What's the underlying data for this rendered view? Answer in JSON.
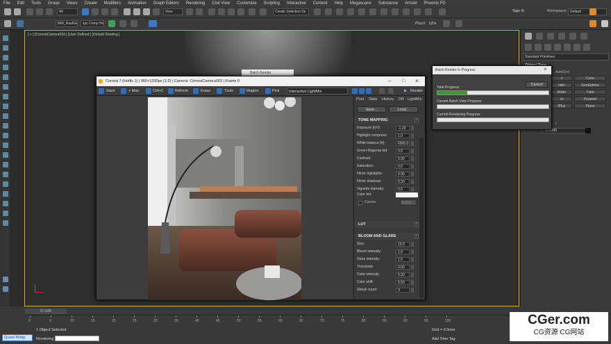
{
  "menu": [
    "File",
    "Edit",
    "Tools",
    "Group",
    "Views",
    "Create",
    "Modifiers",
    "Animation",
    "Graph Editors",
    "Rendering",
    "Civil View",
    "Customize",
    "Scripting",
    "Interactive",
    "Content",
    "Help",
    "Megascans",
    "Substance",
    "Arnold",
    "Phoenix FD"
  ],
  "account": {
    "signin": "Sign In",
    "workspaces_label": "Workspaces:",
    "workspace": "Default"
  },
  "toolbar": {
    "filter": "All",
    "view": "View",
    "selection_set": "Create Selection Se",
    "mw_label": "MW_RaafGen",
    "comp_label": "spc Comp Heli",
    "physx": "PhysX",
    "tylda": "tyDa"
  },
  "viewport": {
    "label": "[ + ] [CoronaCamera004 ] [User Defined ] [Default Shading ]"
  },
  "right_panel": {
    "section_primitives": "Standard Primitives",
    "object_type": "Object Type",
    "autogrid": "AutoGrid",
    "buttons": [
      "Cone",
      "GeoSphere",
      "Tube",
      "Pyramid",
      "Plane"
    ],
    "partial": [
      "x",
      "nder",
      "linder",
      "ot",
      "lPlus"
    ],
    "name_label": "Name and Color",
    "name_value": "Box006"
  },
  "vfb": {
    "title": "Corona 7 (Hotfix 1) | 960×1200px (1:2) | Camera: CoronaCamera003 | Frame 0",
    "toolbar": [
      "Save",
      "+ Max",
      "Ctrl+C",
      "Refresh",
      "Erase",
      "Tools",
      "Region",
      "Pick",
      "Interactive LightMix",
      "Render"
    ],
    "tabs": [
      "Post",
      "Stats",
      "History",
      "DR",
      "LightMix"
    ],
    "save": "Save...",
    "load": "Load...",
    "tone_mapping": "TONE MAPPING",
    "params": [
      {
        "label": "Exposure (EV):",
        "value": "-1.20"
      },
      {
        "label": "Highlight compress:",
        "value": "1.0"
      },
      {
        "label": "White balance [K]:",
        "value": "6000.0"
      },
      {
        "label": "Green-Magenta tint:",
        "value": "0.0"
      },
      {
        "label": "Contrast:",
        "value": "0.90"
      },
      {
        "label": "Saturation:",
        "value": "0.0"
      },
      {
        "label": "Filmic highlights:",
        "value": "0.90"
      },
      {
        "label": "Filmic shadows:",
        "value": "0.30"
      },
      {
        "label": "Vignette intensity:",
        "value": "0.0"
      }
    ],
    "color_tint": "Color tint:",
    "curves": "Curves",
    "curves_btn": "Editor...",
    "lut": "LUT",
    "bloom_glare": "BLOOM AND GLARE",
    "bloom_params": [
      {
        "label": "Size:",
        "value": "15.0"
      },
      {
        "label": "Bloom intensity:",
        "value": "1.0"
      },
      {
        "label": "Glare intensity:",
        "value": "1.0"
      },
      {
        "label": "Threshold:",
        "value": "0.50"
      },
      {
        "label": "Color intensity:",
        "value": "0.30"
      },
      {
        "label": "Color shift:",
        "value": "0.50"
      },
      {
        "label": "Streak count:",
        "value": "3"
      }
    ]
  },
  "batch_bg": "Batch Render",
  "batch": {
    "title": "Batch Render In Progress",
    "cancel": "Cancel",
    "total": "Total Progress:",
    "total_progress": 0.27,
    "current_view": "Current Batch View Progress",
    "current_render": "Current Rendering Progress"
  },
  "timeline": {
    "frame": "0 / 100",
    "ticks": [
      "0",
      "5",
      "10",
      "15",
      "20",
      "25",
      "30",
      "35",
      "40",
      "45",
      "50",
      "55",
      "60",
      "65",
      "70",
      "75",
      "80",
      "85",
      "90",
      "95",
      "100"
    ]
  },
  "status": {
    "selected": "1 Object Selected",
    "rendering": "Rendering",
    "quixel": "Quixel Bridg",
    "grid": "Grid = 0.0mm",
    "timetag": "Add Time Tag"
  },
  "watermark": {
    "main": "CGer.com",
    "sub": "CG资源 CG网站"
  }
}
